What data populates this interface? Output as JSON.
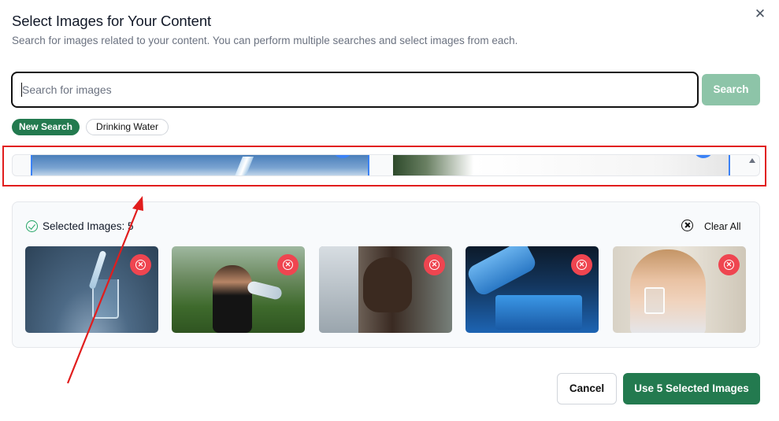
{
  "dialog": {
    "title": "Select Images for Your Content",
    "subtitle": "Search for images related to your content. You can perform multiple searches and select images from each.",
    "close_icon": "close-icon"
  },
  "search": {
    "value": "",
    "placeholder": "Search for images",
    "button_label": "Search"
  },
  "search_history": {
    "new_search_label": "New Search",
    "terms": [
      "Drinking Water"
    ]
  },
  "selected": {
    "label": "Selected Images: 5",
    "count": 5,
    "clear_all_label": "Clear All",
    "remove_icon": "x-circle-icon",
    "images": [
      {
        "subject": "glass of water"
      },
      {
        "subject": "man drinking from bottle"
      },
      {
        "subject": "child drinking from tap"
      },
      {
        "subject": "water poured from bottle"
      },
      {
        "subject": "woman drinking water"
      }
    ]
  },
  "footer": {
    "cancel_label": "Cancel",
    "confirm_label": "Use 5 Selected Images"
  },
  "colors": {
    "primary": "#237a4f",
    "primary_disabled": "#8dc4a8",
    "danger": "#ef4550",
    "annotation": "#e11d1d"
  }
}
